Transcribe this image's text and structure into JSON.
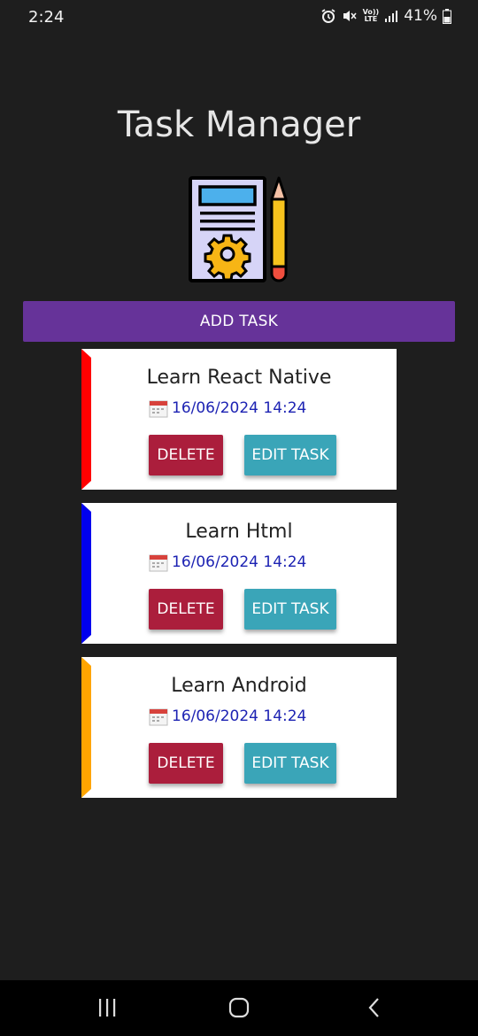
{
  "status_bar": {
    "time": "2:24",
    "lte_top": "Vo))",
    "lte_bottom": "LTE",
    "battery": "41%"
  },
  "app": {
    "title": "Task Manager",
    "add_task_label": "ADD TASK"
  },
  "tasks": [
    {
      "title": "Learn React Native",
      "date": "16/06/2024 14:24",
      "accent": "#ff0000",
      "delete_label": "DELETE",
      "edit_label": "EDIT TASK"
    },
    {
      "title": "Learn Html",
      "date": "16/06/2024 14:24",
      "accent": "#0000ee",
      "delete_label": "DELETE",
      "edit_label": "EDIT TASK"
    },
    {
      "title": "Learn Android",
      "date": "16/06/2024 14:24",
      "accent": "#ffa500",
      "delete_label": "DELETE",
      "edit_label": "EDIT TASK"
    }
  ],
  "colors": {
    "background": "#1e1e1e",
    "add_button": "#663399",
    "delete_button": "#ab1e3c",
    "edit_button": "#3aa5b8",
    "date_text": "#1d23b3"
  },
  "icons": {
    "logo": "document-gear-pencil-icon",
    "calendar": "calendar-icon",
    "nav_recents": "recents-icon",
    "nav_home": "home-icon",
    "nav_back": "back-icon"
  }
}
